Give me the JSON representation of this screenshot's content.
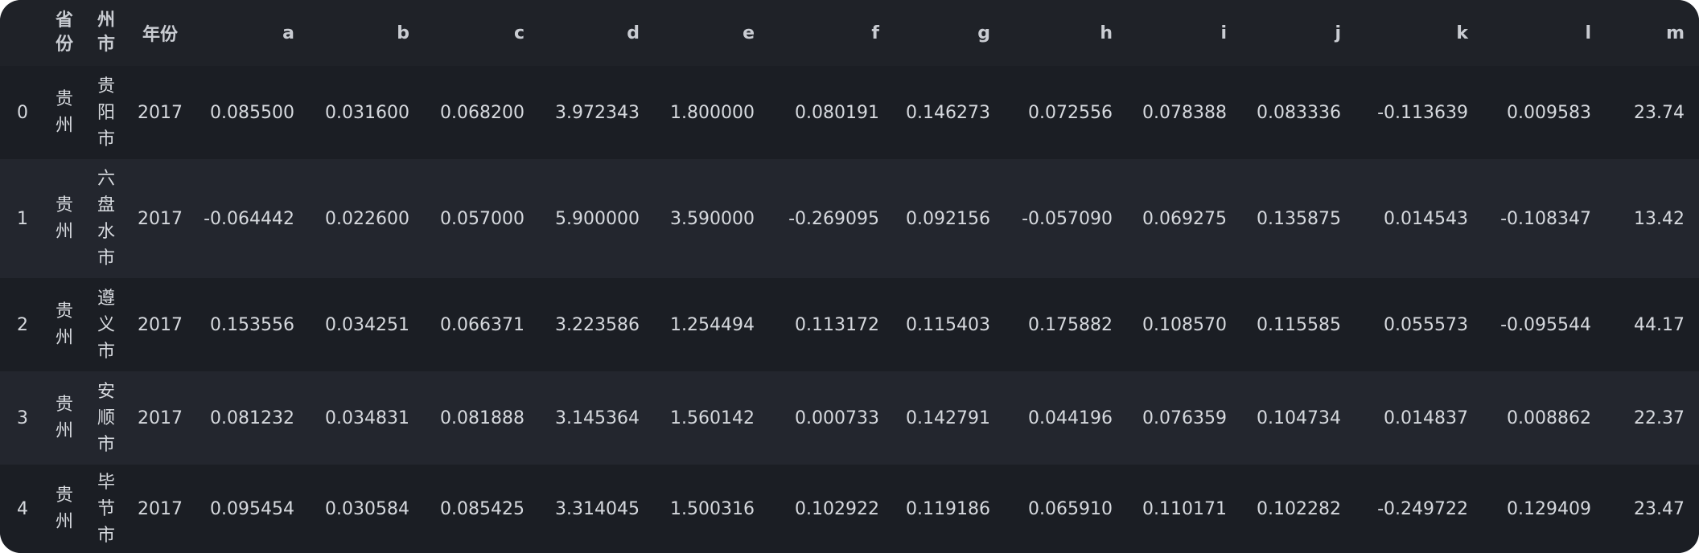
{
  "table": {
    "columns": {
      "index": "",
      "province": "省份",
      "city": "州市",
      "year": "年份",
      "a": "a",
      "b": "b",
      "c": "c",
      "d": "d",
      "e": "e",
      "f": "f",
      "g": "g",
      "h": "h",
      "i": "i",
      "j": "j",
      "k": "k",
      "l": "l",
      "m": "m"
    },
    "rows": [
      {
        "index": "0",
        "province": "贵州",
        "city": "贵阳市",
        "year": "2017",
        "a": "0.085500",
        "b": "0.031600",
        "c": "0.068200",
        "d": "3.972343",
        "e": "1.800000",
        "f": "0.080191",
        "g": "0.146273",
        "h": "0.072556",
        "i": "0.078388",
        "j": "0.083336",
        "k": "-0.113639",
        "l": "0.009583",
        "m": "23.74"
      },
      {
        "index": "1",
        "province": "贵州",
        "city": "六盘水市",
        "year": "2017",
        "a": "-0.064442",
        "b": "0.022600",
        "c": "0.057000",
        "d": "5.900000",
        "e": "3.590000",
        "f": "-0.269095",
        "g": "0.092156",
        "h": "-0.057090",
        "i": "0.069275",
        "j": "0.135875",
        "k": "0.014543",
        "l": "-0.108347",
        "m": "13.42"
      },
      {
        "index": "2",
        "province": "贵州",
        "city": "遵义市",
        "year": "2017",
        "a": "0.153556",
        "b": "0.034251",
        "c": "0.066371",
        "d": "3.223586",
        "e": "1.254494",
        "f": "0.113172",
        "g": "0.115403",
        "h": "0.175882",
        "i": "0.108570",
        "j": "0.115585",
        "k": "0.055573",
        "l": "-0.095544",
        "m": "44.17"
      },
      {
        "index": "3",
        "province": "贵州",
        "city": "安顺市",
        "year": "2017",
        "a": "0.081232",
        "b": "0.034831",
        "c": "0.081888",
        "d": "3.145364",
        "e": "1.560142",
        "f": "0.000733",
        "g": "0.142791",
        "h": "0.044196",
        "i": "0.076359",
        "j": "0.104734",
        "k": "0.014837",
        "l": "0.008862",
        "m": "22.37"
      },
      {
        "index": "4",
        "province": "贵州",
        "city": "毕节市",
        "year": "2017",
        "a": "0.095454",
        "b": "0.030584",
        "c": "0.085425",
        "d": "3.314045",
        "e": "1.500316",
        "f": "0.102922",
        "g": "0.119186",
        "h": "0.065910",
        "i": "0.110171",
        "j": "0.102282",
        "k": "-0.249722",
        "l": "0.129409",
        "m": "23.47"
      }
    ]
  }
}
